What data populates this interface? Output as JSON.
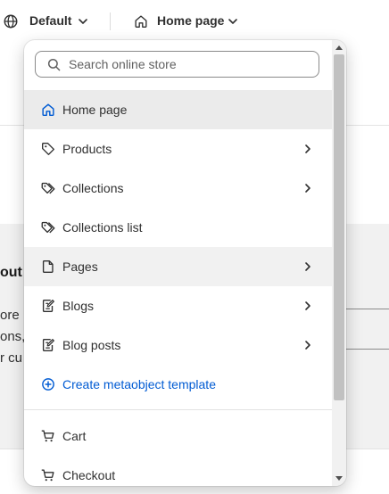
{
  "topbar": {
    "theme_label": "Default",
    "template_label": "Home page"
  },
  "background": {
    "heading_fragment": "out y",
    "text_lines": [
      "ore",
      "ons,",
      "r cu"
    ]
  },
  "dropdown": {
    "search_placeholder": "Search online store",
    "items": [
      {
        "label": "Home page",
        "icon": "home-icon",
        "active": true,
        "has_submenu": false
      },
      {
        "label": "Products",
        "icon": "tag-icon",
        "has_submenu": true
      },
      {
        "label": "Collections",
        "icon": "tags-icon",
        "has_submenu": true
      },
      {
        "label": "Collections list",
        "icon": "tags-icon",
        "has_submenu": false
      },
      {
        "label": "Pages",
        "icon": "page-icon",
        "hovered": true,
        "has_submenu": true
      },
      {
        "label": "Blogs",
        "icon": "blog-icon",
        "has_submenu": true
      },
      {
        "label": "Blog posts",
        "icon": "blog-icon",
        "has_submenu": true
      },
      {
        "label": "Create metaobject template",
        "icon": "plus-circle-icon",
        "has_submenu": false
      }
    ],
    "bottom_items": [
      {
        "label": "Cart",
        "icon": "cart-icon"
      },
      {
        "label": "Checkout",
        "icon": "cart-icon"
      }
    ]
  },
  "colors": {
    "accent": "#005bd3",
    "active_bg": "#ebebeb",
    "text": "#303030"
  }
}
